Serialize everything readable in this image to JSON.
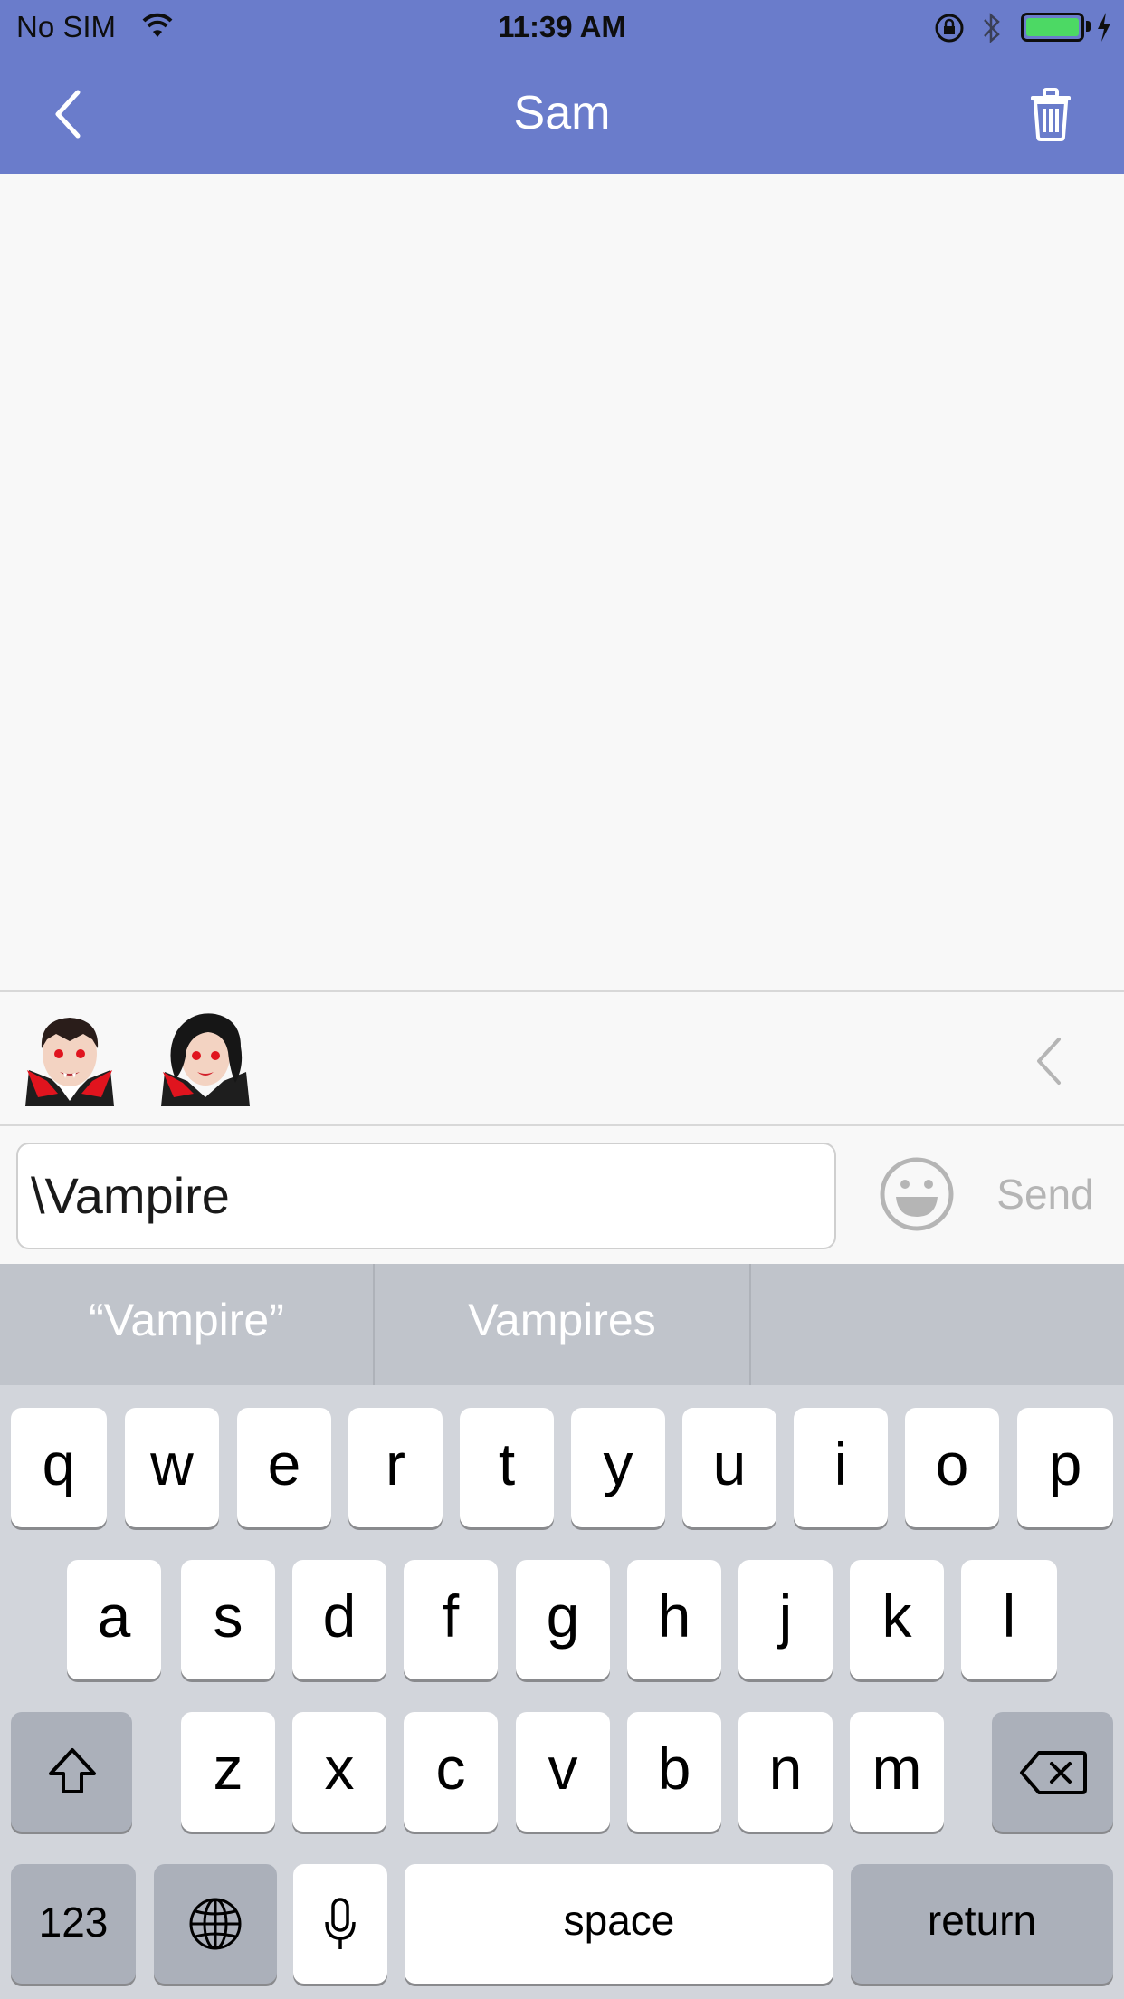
{
  "status_bar": {
    "carrier": "No SIM",
    "time": "11:39 AM",
    "battery_color": "#4cd964"
  },
  "nav": {
    "title": "Sam",
    "back_icon": "chevron-left-icon",
    "delete_icon": "trash-icon",
    "background_color": "#6a7ccb"
  },
  "emoji_bar": {
    "emojis": [
      "🧛‍♂️",
      "🧛‍♀️"
    ],
    "collapse_icon": "chevron-left-icon"
  },
  "composer": {
    "input_value": "\\Vampire",
    "emoji_button_icon": "smiley-icon",
    "send_label": "Send"
  },
  "keyboard": {
    "predictions": [
      "“Vampire”",
      "Vampires",
      ""
    ],
    "row1": [
      "q",
      "w",
      "e",
      "r",
      "t",
      "y",
      "u",
      "i",
      "o",
      "p"
    ],
    "row2": [
      "a",
      "s",
      "d",
      "f",
      "g",
      "h",
      "j",
      "k",
      "l"
    ],
    "row3": [
      "z",
      "x",
      "c",
      "v",
      "b",
      "n",
      "m"
    ],
    "numbers_label": "123",
    "space_label": "space",
    "return_label": "return",
    "shift_icon": "shift-icon",
    "delete_icon": "backspace-icon",
    "globe_icon": "globe-icon",
    "mic_icon": "microphone-icon"
  }
}
